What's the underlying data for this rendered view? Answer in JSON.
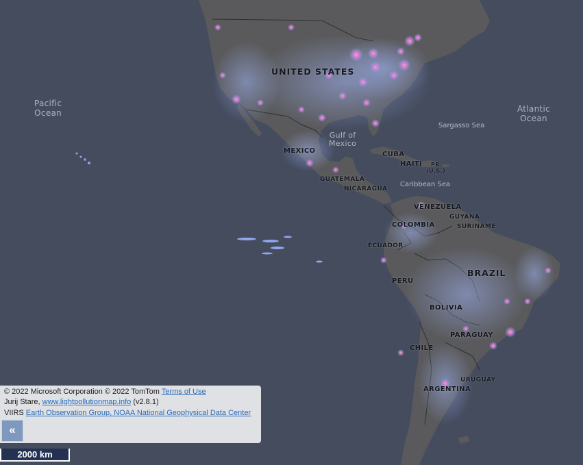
{
  "map": {
    "oceans": [
      {
        "id": "pacific",
        "line1": "Pacific",
        "line2": "Ocean"
      },
      {
        "id": "atlantic",
        "line1": "Atlantic",
        "line2": "Ocean"
      },
      {
        "id": "gulf",
        "line1": "Gulf of",
        "line2": "Mexico"
      }
    ],
    "seas": {
      "sargasso": "Sargasso Sea",
      "caribbean": "Caribbean Sea"
    },
    "countries": {
      "usa": "UNITED STATES",
      "mexico": "MEXICO",
      "cuba": "CUBA",
      "haiti": "HAITI",
      "pr_line1": "PR",
      "pr_line2": "(U.S.)",
      "guatemala": "GUATEMALA",
      "nicaragua": "NICARAGUA",
      "venezuela": "VENEZUELA",
      "guyana": "GUYANA",
      "suriname": "SURINAME",
      "colombia": "COLOMBIA",
      "ecuador": "ECUADOR",
      "brazil": "BRAZIL",
      "peru": "PERU",
      "bolivia": "BOLIVIA",
      "paraguay": "PARAGUAY",
      "chile": "CHILE",
      "uruguay": "URUGUAY",
      "argentina": "ARGENTINA"
    },
    "colors": {
      "ocean": "#444c5e",
      "land": "#5a5a5c",
      "light_low": "#8fa6ee",
      "light_mid": "#d77ee0",
      "light_high": "#ff9a5a"
    }
  },
  "attribution": {
    "line1_text": "© 2022 Microsoft Corporation © 2022 TomTom ",
    "line1_link": "Terms of Use",
    "line2_text": "Jurij Stare, ",
    "line2_link": "www.lightpollutionmap.info",
    "line2_suffix": " (v2.8.1)",
    "line3_text": "VIIRS ",
    "line3_link": "Earth Observation Group, NOAA National Geophysical Data Center",
    "collapse_icon": "«"
  },
  "scale": {
    "label": "2000 km"
  }
}
